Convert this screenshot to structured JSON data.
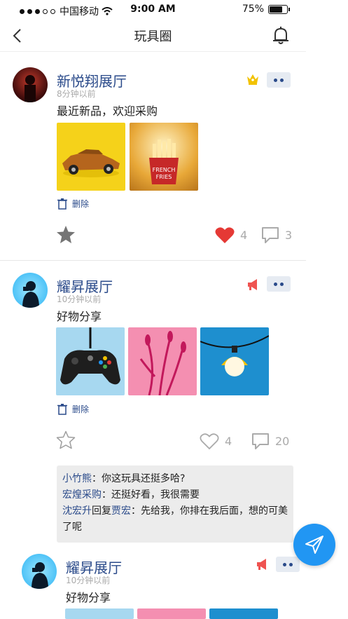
{
  "status_bar": {
    "carrier": "中国移动",
    "time": "9:00 AM",
    "battery": "75%",
    "battery_level": 0.75
  },
  "nav": {
    "title": "玩具圈"
  },
  "posts": [
    {
      "name": "新悦翔展厅",
      "time": "8分钟以前",
      "content": "最近新品，欢迎采购",
      "badge_icon": "crown-icon",
      "images": [
        "yellow-toy-car",
        "french-fries"
      ],
      "delete_label": "删除",
      "favorited": true,
      "likes": "4",
      "liked": true,
      "comments_count": "3"
    },
    {
      "name": "耀昇展厅",
      "time": "10分钟以前",
      "content": "好物分享",
      "badge_icon": "megaphone-icon",
      "images": [
        "game-controller",
        "pink-flowers",
        "pendant-lamp"
      ],
      "delete_label": "删除",
      "favorited": false,
      "likes": "4",
      "liked": false,
      "comments_count": "20",
      "comments": [
        {
          "author": "小竹熊",
          "text": "：你这玩具还挺多哈?"
        },
        {
          "author": "宏煌采购",
          "text": "：还挺好看，我很需要"
        },
        {
          "author": "沈宏升",
          "reply_word": "回复",
          "reply_to": "贾宏",
          "text": "：先给我，你排在我后面，想的可美了呢"
        }
      ]
    },
    {
      "name": "耀昇展厅",
      "time": "10分钟以前",
      "content": "好物分享",
      "badge_icon": "megaphone-icon"
    }
  ],
  "colors": {
    "accent": "#2a4a8a",
    "fab": "#2196f3",
    "heart": "#e53935",
    "crown": "#f2c200",
    "megaphone": "#ef5350"
  }
}
